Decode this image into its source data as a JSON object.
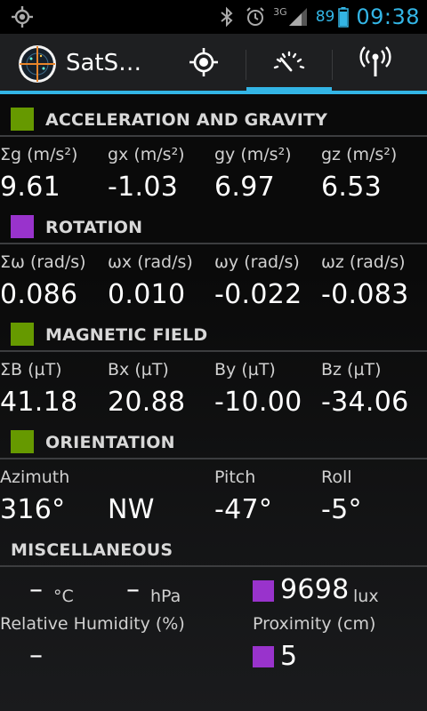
{
  "status_bar": {
    "network": "3G",
    "battery_percent": "89",
    "time": "09:38",
    "icons": [
      "gps-icon",
      "bluetooth-icon",
      "alarm-icon",
      "signal-icon",
      "battery-icon"
    ]
  },
  "action_bar": {
    "title": "SatS…",
    "tabs": [
      {
        "name": "gps",
        "icon": "gps-crosshair-icon",
        "selected": false
      },
      {
        "name": "sensors",
        "icon": "gauge-icon",
        "selected": true
      },
      {
        "name": "signal",
        "icon": "antenna-icon",
        "selected": false
      }
    ],
    "accent_color": "#33b5e5"
  },
  "sections": {
    "acceleration": {
      "title": "ACCELERATION AND GRAVITY",
      "color": "#669900",
      "labels": [
        "Σg (m/s²)",
        "gx (m/s²)",
        "gy (m/s²)",
        "gz (m/s²)"
      ],
      "values": [
        "9.61",
        "-1.03",
        "6.97",
        "6.53"
      ]
    },
    "rotation": {
      "title": "ROTATION",
      "color": "#9933cc",
      "labels": [
        "Σω (rad/s)",
        "ωx (rad/s)",
        "ωy (rad/s)",
        "ωz (rad/s)"
      ],
      "values": [
        "0.086",
        "0.010",
        "-0.022",
        "-0.083"
      ]
    },
    "magnetic": {
      "title": "MAGNETIC FIELD",
      "color": "#669900",
      "labels": [
        "ΣB (µT)",
        "Bx (µT)",
        "By (µT)",
        "Bz (µT)"
      ],
      "values": [
        "41.18",
        "20.88",
        "-10.00",
        "-34.06"
      ]
    },
    "orientation": {
      "title": "ORIENTATION",
      "color": "#669900",
      "labels": [
        "Azimuth",
        "Pitch",
        "Roll"
      ],
      "values": [
        "316°",
        "NW",
        "-47°",
        "-5°"
      ]
    },
    "misc": {
      "title": "MISCELLANEOUS",
      "temperature_value": "–",
      "temperature_unit": "°C",
      "pressure_value": "–",
      "pressure_unit": "hPa",
      "light_value": "9698",
      "light_unit": "lux",
      "light_color": "#9933cc",
      "humidity_label": "Relative Humidity (%)",
      "humidity_value": "–",
      "proximity_label": "Proximity (cm)",
      "proximity_value": "5",
      "proximity_color": "#9933cc"
    }
  }
}
